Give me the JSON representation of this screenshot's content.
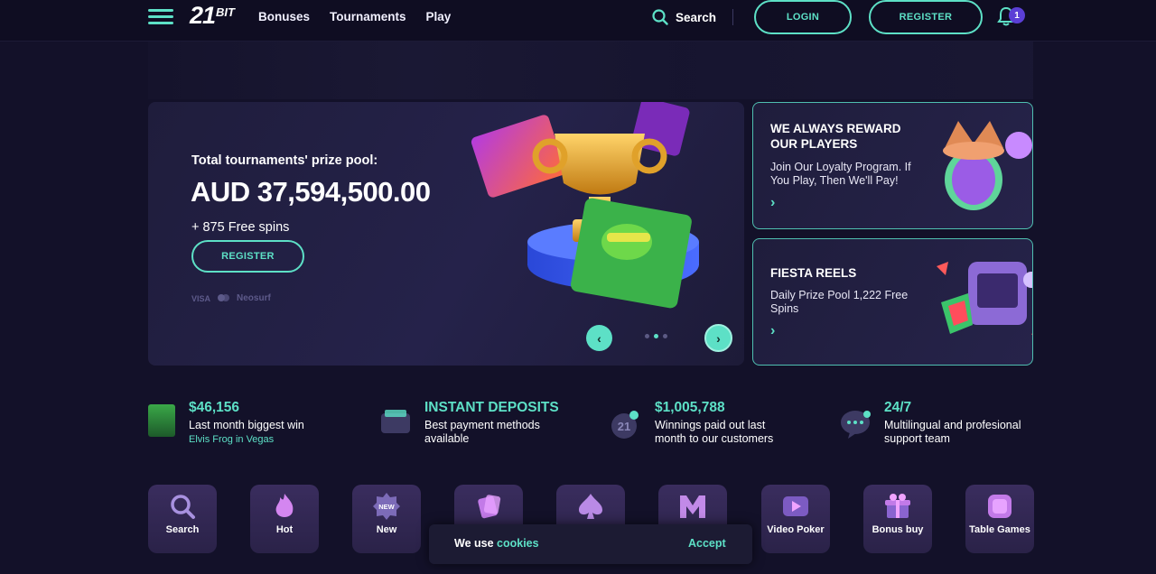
{
  "header": {
    "logo_main": "21",
    "logo_sub": "BIT",
    "nav": [
      "Bonuses",
      "Tournaments",
      "Play"
    ],
    "search_label": "Search",
    "login_label": "LOGIN",
    "register_label": "REGISTER",
    "notification_count": "1"
  },
  "hero": {
    "label": "Total tournaments' prize pool:",
    "amount": "AUD 37,594,500.00",
    "spins": "+ 875 Free spins",
    "register_label": "REGISTER",
    "payments": [
      "VISA",
      "Neosurf"
    ],
    "slider": {
      "count": 3,
      "active": 1
    }
  },
  "promos": [
    {
      "title": "WE ALWAYS REWARD OUR PLAYERS",
      "text": "Join Our Loyalty Program. If You Play, Then We'll Pay!"
    },
    {
      "title": "FIESTA REELS",
      "text": "Daily Prize Pool 1,222 Free Spins"
    }
  ],
  "stats": [
    {
      "value": "$46,156",
      "desc": "Last month biggest win",
      "sub": "Elvis Frog in Vegas",
      "icon": "game-thumbnail"
    },
    {
      "value": "INSTANT DEPOSITS",
      "desc": "Best payment methods available",
      "icon": "wallet-icon"
    },
    {
      "value": "$1,005,788",
      "desc": "Winnings paid out last month to our customers",
      "icon": "coin-icon"
    },
    {
      "value": "24/7",
      "desc": "Multilingual and profesional support team",
      "icon": "chat-icon"
    }
  ],
  "categories": [
    {
      "label": "Search",
      "icon": "search-icon"
    },
    {
      "label": "Hot",
      "icon": "flame-icon"
    },
    {
      "label": "New",
      "icon": "new-badge-icon"
    },
    {
      "label": "",
      "icon": "cards-icon"
    },
    {
      "label": "",
      "icon": "spade-icon"
    },
    {
      "label": "",
      "icon": "m-icon"
    },
    {
      "label": "Video Poker",
      "icon": "play-icon"
    },
    {
      "label": "Bonus buy",
      "icon": "gift-icon"
    },
    {
      "label": "Table Games",
      "icon": "chip-icon"
    }
  ],
  "cookie": {
    "prefix": "We use",
    "link": "cookies",
    "accept": "Accept"
  },
  "colors": {
    "accent": "#5de0c6",
    "background": "#131129",
    "topbar": "#0f0d22",
    "badge": "#5b3fd6"
  }
}
